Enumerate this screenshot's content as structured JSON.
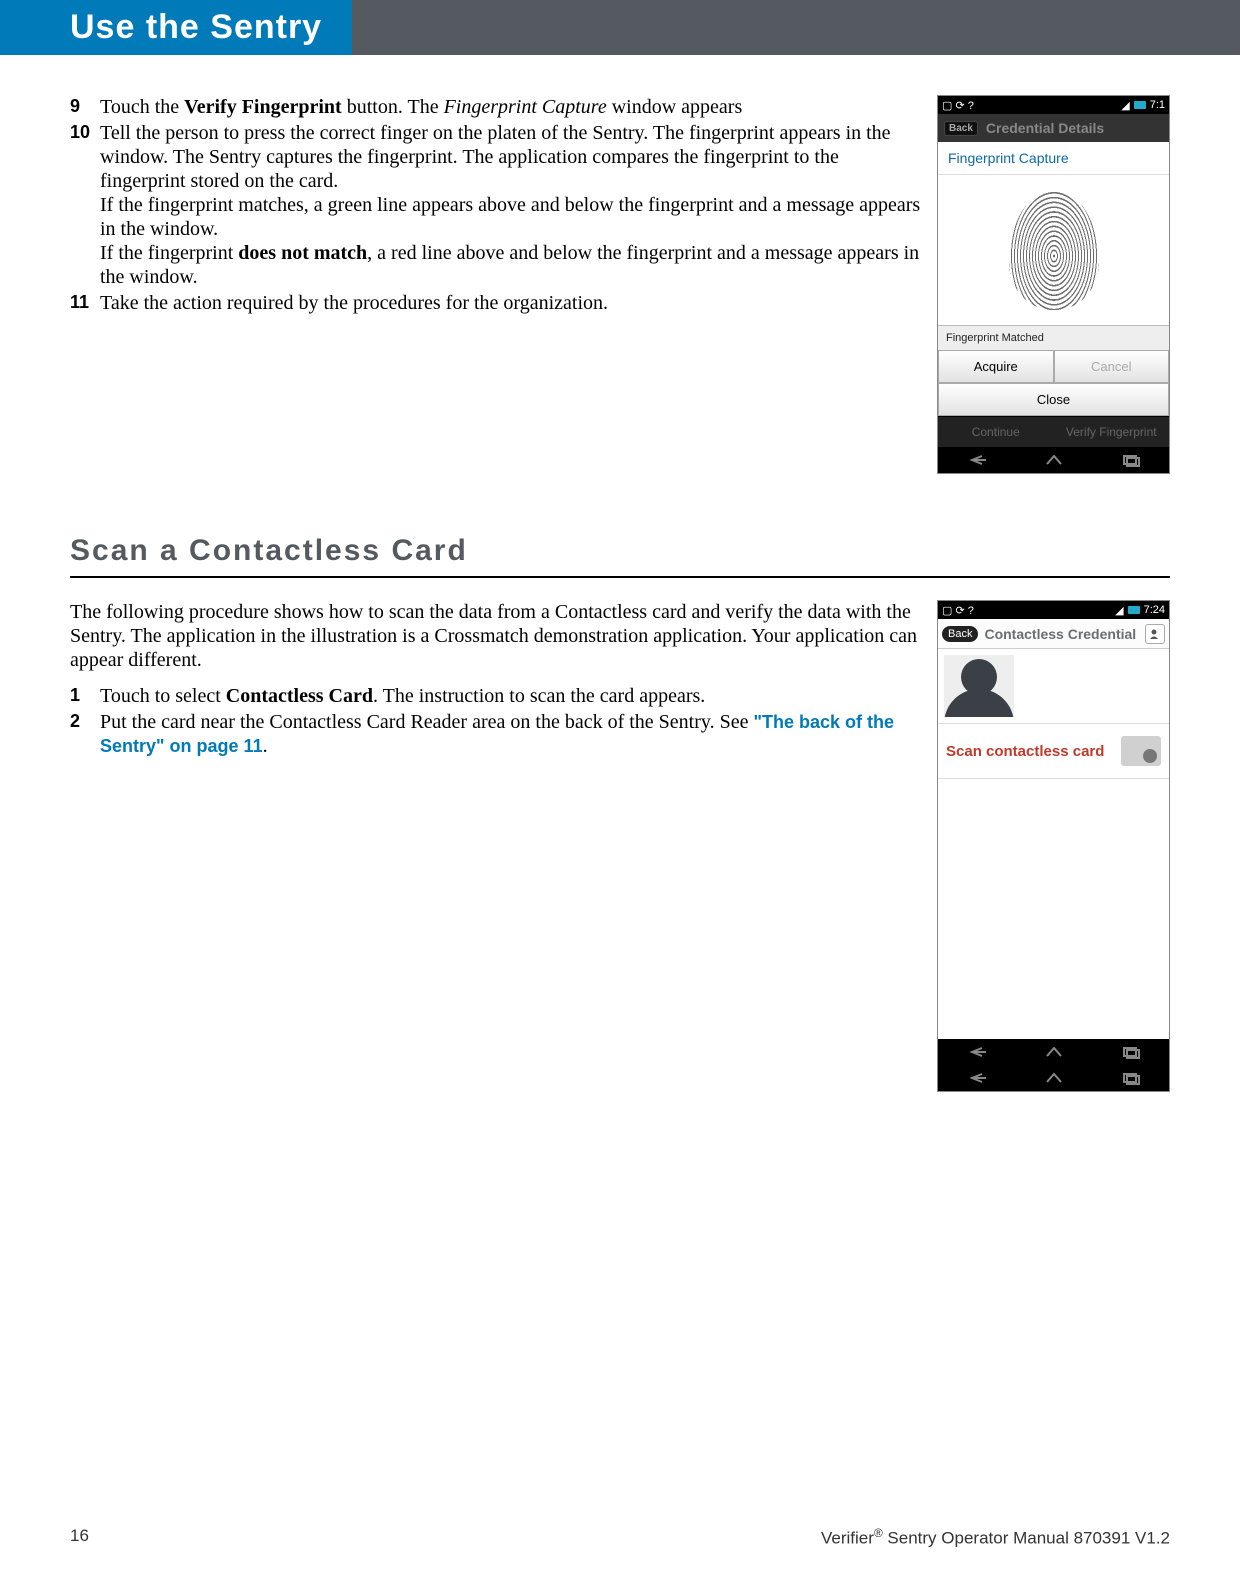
{
  "header": {
    "chapter_title": "Use the Sentry"
  },
  "steps_a": [
    {
      "num": "9",
      "parts": [
        {
          "t": "Touch the "
        },
        {
          "t": "Verify Fingerprint",
          "b": true
        },
        {
          "t": " button. The "
        },
        {
          "t": "Fingerprint Capture",
          "i": true
        },
        {
          "t": " window appears"
        }
      ]
    },
    {
      "num": "10",
      "parts": [
        {
          "t": "Tell the person to press the correct finger on the platen of the Sentry. The fingerprint appears in the window. The Sentry captures the fingerprint. The application compares the fingerprint to the fingerprint stored on the card."
        },
        {
          "br": true
        },
        {
          "t": "If the fingerprint matches, a green line appears above and below the fingerprint and a message appears in the window."
        },
        {
          "br": true
        },
        {
          "t": "If the fingerprint "
        },
        {
          "t": "does not match",
          "b": true
        },
        {
          "t": ", a red line above and below the fingerprint and a message appears in the window."
        }
      ]
    },
    {
      "num": "11",
      "parts": [
        {
          "t": "Take the action required by the procedures for the organization."
        }
      ]
    }
  ],
  "section_b": {
    "heading": "Scan a Contactless Card"
  },
  "intro_b": {
    "parts": [
      {
        "t": "The following procedure shows how to scan the data from a Contactless card and verify the data with the Sentry. The application in the illustration is a Crossmatch demonstration application. Your application can appear different."
      }
    ]
  },
  "steps_b": [
    {
      "num": "1",
      "parts": [
        {
          "t": "Touch to select "
        },
        {
          "t": "Contactless Card",
          "b": true
        },
        {
          "t": ". The instruction to scan the card appears."
        }
      ]
    },
    {
      "num": "2",
      "parts": [
        {
          "t": "Put the card near the Contactless Card Reader area on the back of the Sentry.  See "
        },
        {
          "t": "\"The back of the Sentry\" on page 11",
          "link": true
        },
        {
          "t": "."
        }
      ]
    }
  ],
  "screenshot1": {
    "status_time": "7:1",
    "back": "Back",
    "app_title": "Credential Details",
    "panel_title": "Fingerprint Capture",
    "status_text": "Fingerprint Matched",
    "btn_acquire": "Acquire",
    "btn_cancel": "Cancel",
    "btn_close": "Close",
    "btn_continue": "Continue",
    "btn_verify": "Verify Fingerprint"
  },
  "screenshot2": {
    "status_time": "7:24",
    "back": "Back",
    "app_title": "Contactless Credential",
    "scan_label": "Scan contactless card"
  },
  "footer": {
    "page": "16",
    "doc_prefix": "Verifier",
    "doc_rest": " Sentry Operator Manual 870391 V1.2"
  }
}
